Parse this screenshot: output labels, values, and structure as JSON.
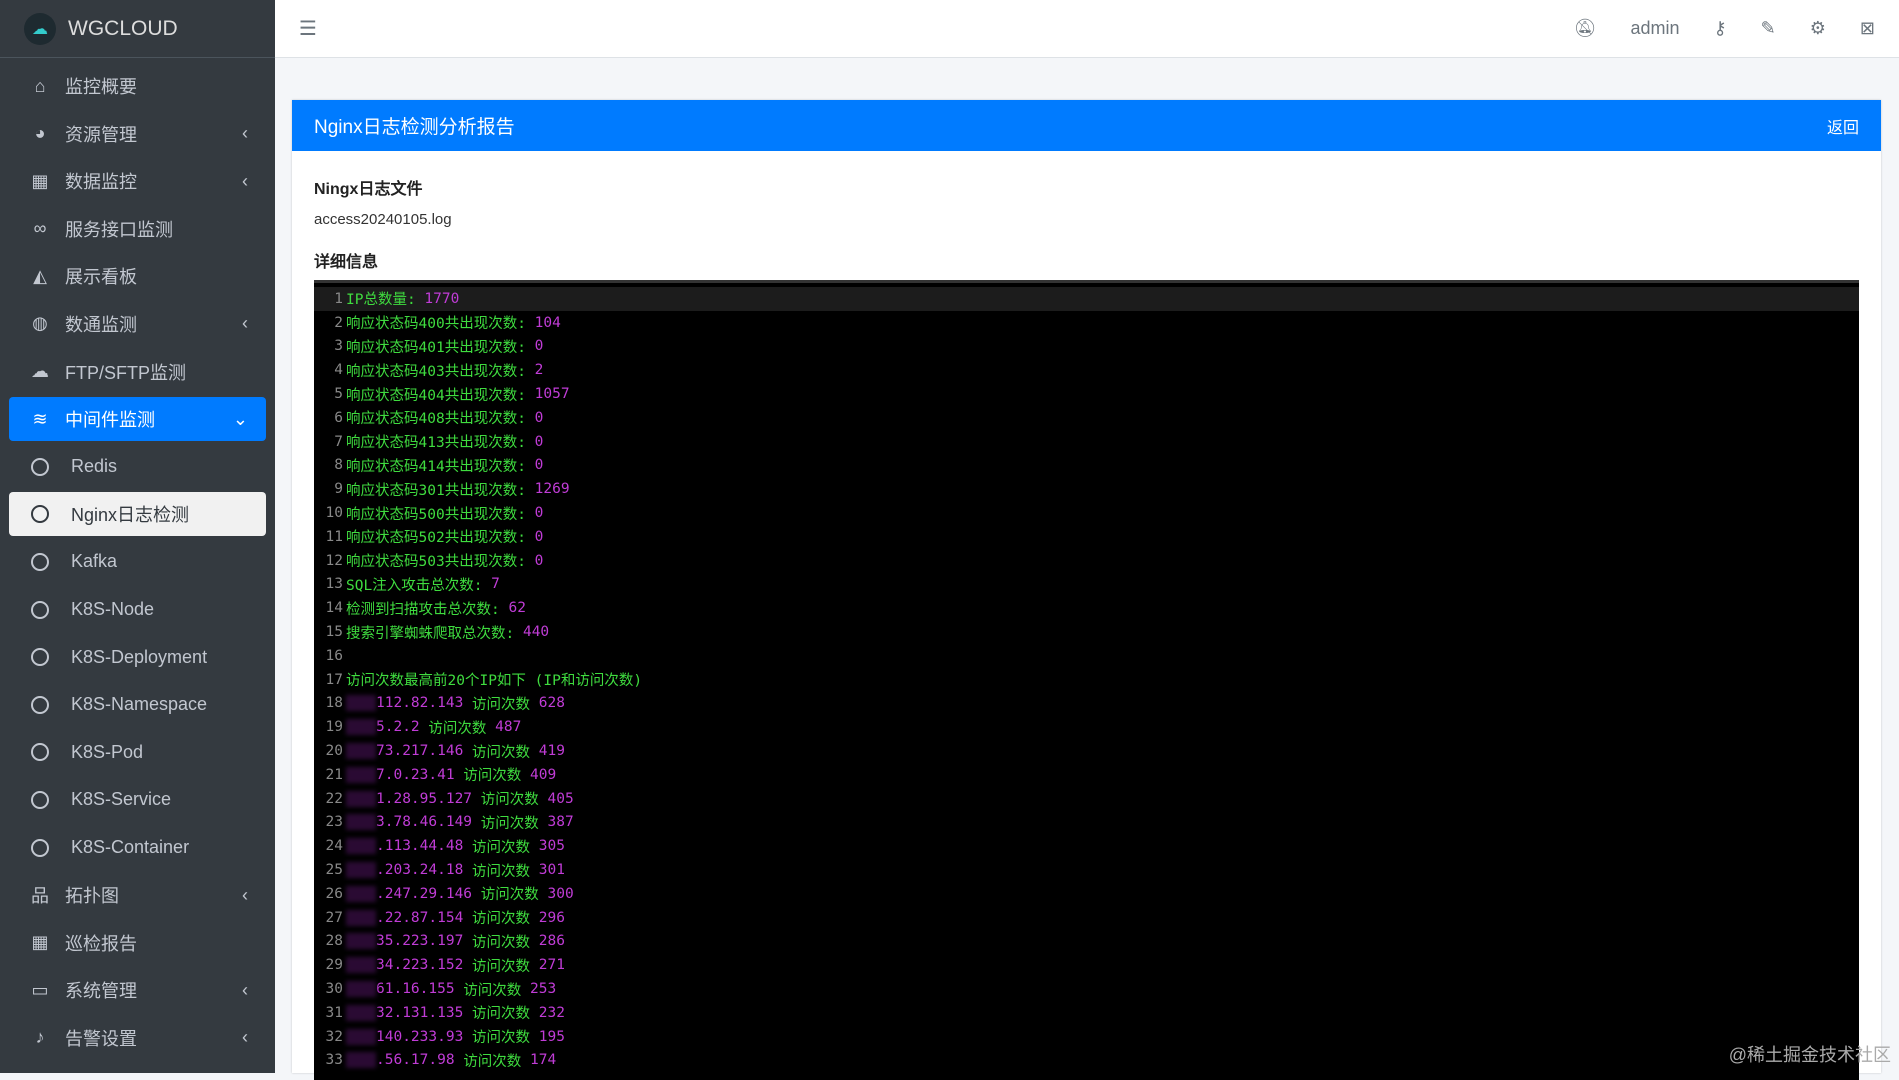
{
  "brand": "WGCLOUD",
  "sidebar": [
    {
      "label": "监控概要",
      "icon": "home-icon",
      "glyph": "⌂",
      "chev": ""
    },
    {
      "label": "资源管理",
      "icon": "palette-icon",
      "glyph": "◕",
      "chev": "‹"
    },
    {
      "label": "数据监控",
      "icon": "table-icon",
      "glyph": "▦",
      "chev": "‹"
    },
    {
      "label": "服务接口监测",
      "icon": "link-icon",
      "glyph": "∞",
      "chev": ""
    },
    {
      "label": "展示看板",
      "icon": "chart-area-icon",
      "glyph": "◭",
      "chev": ""
    },
    {
      "label": "数通监测",
      "icon": "globe-icon",
      "glyph": "◍",
      "chev": "‹"
    },
    {
      "label": "FTP/SFTP监测",
      "icon": "cloud-upload-icon",
      "glyph": "☁",
      "chev": ""
    },
    {
      "label": "中间件监测",
      "icon": "layers-icon",
      "glyph": "≋",
      "chev": "⌄"
    }
  ],
  "subitems": [
    "Redis",
    "Nginx日志检测",
    "Kafka",
    "K8S-Node",
    "K8S-Deployment",
    "K8S-Namespace",
    "K8S-Pod",
    "K8S-Service",
    "K8S-Container"
  ],
  "sidebar2": [
    {
      "label": "拓扑图",
      "icon": "sitemap-icon",
      "glyph": "品",
      "chev": "‹"
    },
    {
      "label": "巡检报告",
      "icon": "calendar-icon",
      "glyph": "▦",
      "chev": ""
    },
    {
      "label": "系统管理",
      "icon": "laptop-icon",
      "glyph": "▭",
      "chev": "‹"
    },
    {
      "label": "告警设置",
      "icon": "bell-icon",
      "glyph": "♪",
      "chev": "‹"
    }
  ],
  "topbar": {
    "user": "admin"
  },
  "panel": {
    "title": "Nginx日志检测分析报告",
    "back": "返回",
    "file_label": "Ningx日志文件",
    "file": "access20240105.log",
    "detail_label": "详细信息"
  },
  "lines": [
    [
      "IP总数量: ",
      "1770"
    ],
    [
      "响应状态码400共出现次数: ",
      "104"
    ],
    [
      "响应状态码401共出现次数: ",
      "0"
    ],
    [
      "响应状态码403共出现次数: ",
      "2"
    ],
    [
      "响应状态码404共出现次数: ",
      "1057"
    ],
    [
      "响应状态码408共出现次数: ",
      "0"
    ],
    [
      "响应状态码413共出现次数: ",
      "0"
    ],
    [
      "响应状态码414共出现次数: ",
      "0"
    ],
    [
      "响应状态码301共出现次数: ",
      "1269"
    ],
    [
      "响应状态码500共出现次数: ",
      "0"
    ],
    [
      "响应状态码502共出现次数: ",
      "0"
    ],
    [
      "响应状态码503共出现次数: ",
      "0"
    ],
    [
      "SQL注入攻击总次数: ",
      "7"
    ],
    [
      "检测到扫描攻击总次数: ",
      "62"
    ],
    [
      "搜索引擎蜘蛛爬取总次数: ",
      "440"
    ],
    [
      "",
      ""
    ],
    [
      "访问次数最高前20个IP如下 (IP和访问次数)",
      ""
    ]
  ],
  "ips": [
    [
      "112.82.143",
      "628"
    ],
    [
      "5.2.2",
      "487"
    ],
    [
      "73.217.146",
      "419"
    ],
    [
      "7.0.23.41",
      "409"
    ],
    [
      "1.28.95.127",
      "405"
    ],
    [
      "3.78.46.149",
      "387"
    ],
    [
      ".113.44.48",
      "305"
    ],
    [
      ".203.24.18",
      "301"
    ],
    [
      ".247.29.146",
      "300"
    ],
    [
      ".22.87.154",
      "296"
    ],
    [
      "35.223.197",
      "286"
    ],
    [
      "34.223.152",
      "271"
    ],
    [
      "61.16.155",
      "253"
    ],
    [
      "32.131.135",
      "232"
    ],
    [
      "140.233.93",
      "195"
    ],
    [
      ".56.17.98",
      "174"
    ]
  ],
  "ip_label": "访问次数",
  "watermark": "@稀土掘金技术社区"
}
